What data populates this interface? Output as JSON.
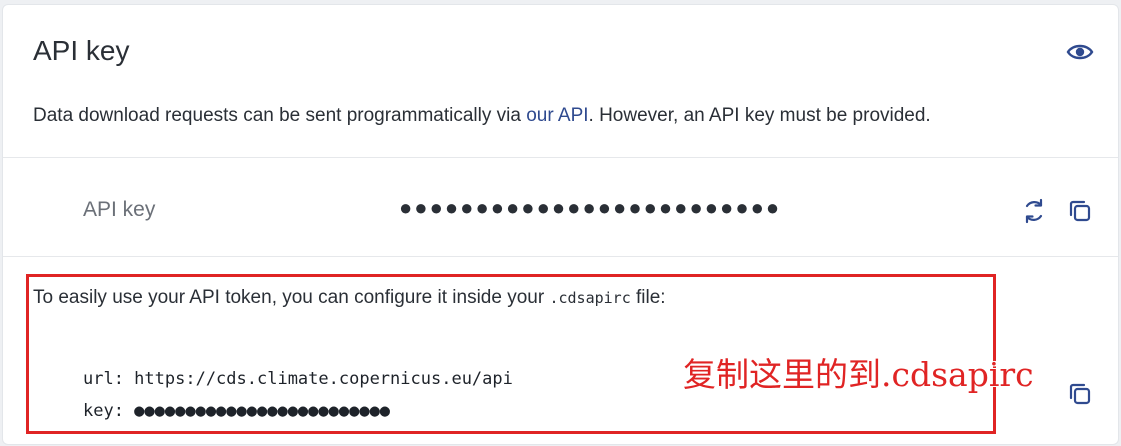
{
  "header": {
    "title": "API key",
    "description_prefix": "Data download requests can be sent programmatically via ",
    "description_link": "our API",
    "description_suffix": ". However, an API key must be provided."
  },
  "key_row": {
    "label": "API key",
    "masked_value": "●●●●●●●●●●●●●●●●●●●●●●●●●"
  },
  "config": {
    "intro_prefix": "To easily use your API token, you can configure it inside your ",
    "filename": ".cdsapirc",
    "intro_suffix": " file:",
    "url_line": "url: https://cds.climate.copernicus.eu/api",
    "key_line": "key: ●●●●●●●●●●●●●●●●●●●●●●●●●"
  },
  "annotation": {
    "text": "复制这里的到.cdsapirc"
  },
  "icons": {
    "visibility": "eye-icon",
    "regenerate": "refresh-icon",
    "copy_key": "copy-icon",
    "copy_config": "copy-icon"
  },
  "colors": {
    "accent": "#2f4a8f",
    "highlight": "#e02424"
  }
}
